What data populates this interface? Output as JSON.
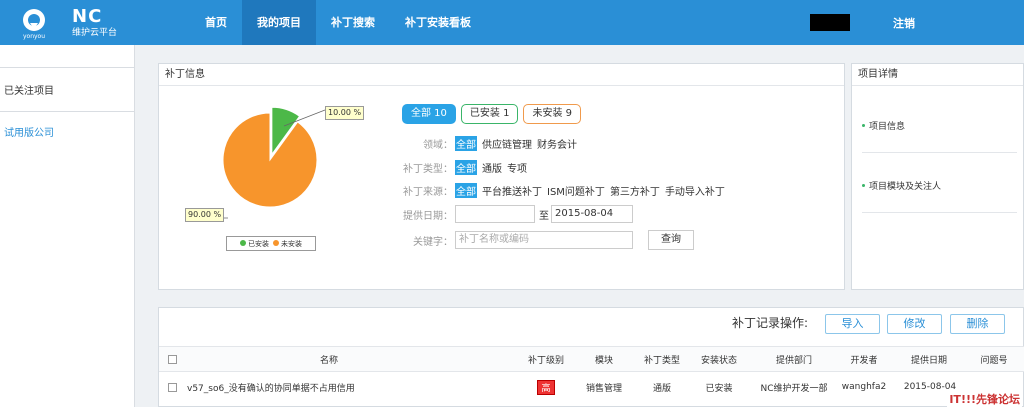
{
  "header": {
    "brand": "NC",
    "brand_sub": "维护云平台",
    "logo_caption": "yonyou",
    "nav": [
      "首页",
      "我的项目",
      "补丁搜索",
      "补丁安装看板"
    ],
    "active_nav": 1,
    "logout": "注销"
  },
  "sidebar": {
    "items": [
      "已关注项目",
      "试用版公司"
    ]
  },
  "patch_info": {
    "title": "补丁信息",
    "filter_buttons": {
      "all": "全部 10",
      "installed": "已安装 1",
      "not_installed": "未安装 9"
    },
    "domain_label": "领域：",
    "domain_tags": [
      "全部",
      "供应链管理",
      "财务会计"
    ],
    "type_label": "补丁类型：",
    "type_tags": [
      "全部",
      "通版",
      "专项"
    ],
    "source_label": "补丁来源：",
    "source_tags": [
      "全部",
      "平台推送补丁",
      "ISM问题补丁",
      "第三方补丁",
      "手动导入补丁"
    ],
    "date_label": "提供日期：",
    "date_from": "",
    "date_sep": "至",
    "date_to": "2015-08-04",
    "keyword_label": "关键字：",
    "keyword_placeholder": "补丁名称或编码",
    "query_button": "查询",
    "pie_callouts": {
      "installed": "10.00 %",
      "not_installed": "90.00 %"
    },
    "legend": {
      "installed": "已安装",
      "not_installed": "未安装"
    },
    "colors": {
      "installed": "#4cb848",
      "not_installed": "#f7952c"
    }
  },
  "chart_data": {
    "type": "pie",
    "labels": [
      "已安装",
      "未安装"
    ],
    "values": [
      10.0,
      90.0
    ]
  },
  "project_detail": {
    "title": "项目详情",
    "items": [
      "项目信息",
      "项目模块及关注人"
    ]
  },
  "records": {
    "ops_label": "补丁记录操作:",
    "buttons": {
      "import": "导入",
      "edit": "修改",
      "delete": "删除"
    },
    "columns": [
      "名称",
      "补丁级别",
      "模块",
      "补丁类型",
      "安装状态",
      "提供部门",
      "开发者",
      "提供日期",
      "问题号"
    ],
    "rows": [
      {
        "name": "v57_so6_没有确认的协同单据不占用信用",
        "level": "高",
        "module": "销售管理",
        "type": "通版",
        "status": "已安装",
        "dept": "NC维护开发一部",
        "developer": "wanghfa2",
        "date": "2015-08-04",
        "issue": ""
      }
    ]
  },
  "watermark": "IT!!!先锋论坛"
}
